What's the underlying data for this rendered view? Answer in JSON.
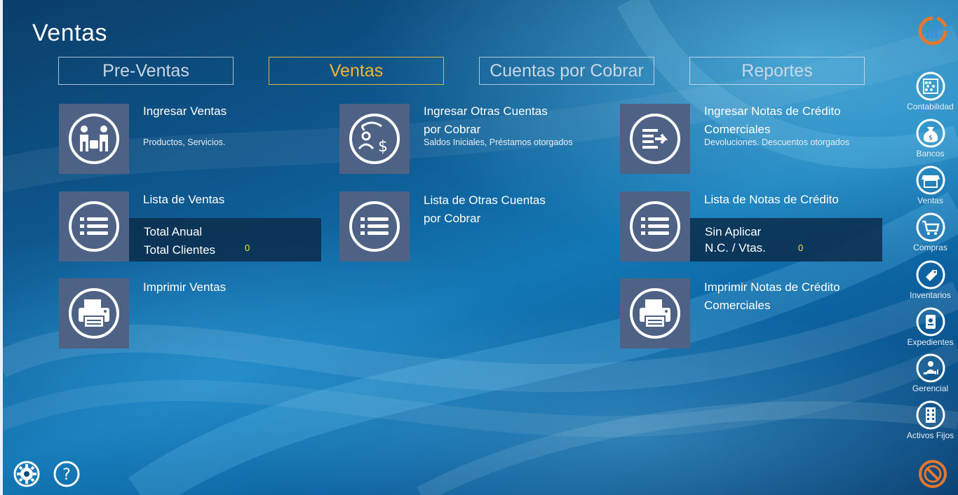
{
  "page": {
    "title": "Ventas"
  },
  "tabs": [
    {
      "label": "Pre-Ventas"
    },
    {
      "label": "Ventas"
    },
    {
      "label": "Cuentas por Cobrar"
    },
    {
      "label": "Reportes"
    }
  ],
  "tiles": {
    "ingresar_ventas": {
      "title": "Ingresar Ventas",
      "subtitle": "Productos, Servicios.",
      "icon": "buyer-seller-icon"
    },
    "ingresar_otras_cuentas": {
      "title_line1": "Ingresar Otras Cuentas",
      "title_line2": "por Cobrar",
      "subtitle": "Saldos Iniciales, Préstamos otorgados",
      "icon": "receivable-icon"
    },
    "ingresar_notas_credito": {
      "title_line1": "Ingresar Notas de Crédito",
      "title_line2": "Comerciales",
      "subtitle": "Devoluciones. Descuentos otorgados",
      "icon": "list-arrow-icon"
    },
    "lista_ventas": {
      "title": "Lista de Ventas",
      "stat_label1": "Total Anual",
      "stat_label2": "Total Clientes",
      "stat_value": "0",
      "icon": "list-icon"
    },
    "lista_otras_cuentas": {
      "title_line1": "Lista de Otras Cuentas",
      "title_line2": "por Cobrar",
      "icon": "list-icon"
    },
    "lista_notas_credito": {
      "title": "Lista de Notas de Crédito",
      "stat_label1": "Sin Aplicar",
      "stat_label2": "N.C. / Vtas.",
      "stat_value": "0",
      "icon": "list-icon"
    },
    "imprimir_ventas": {
      "title": "Imprimir Ventas",
      "icon": "printer-icon"
    },
    "imprimir_notas_credito": {
      "title_line1": "Imprimir Notas de Crédito",
      "title_line2": "Comerciales",
      "icon": "printer-icon"
    }
  },
  "sidebar": {
    "items": [
      {
        "label": "Contabilidad",
        "icon": "abacus-icon"
      },
      {
        "label": "Bancos",
        "icon": "money-bag-icon"
      },
      {
        "label": "Ventas",
        "icon": "store-icon"
      },
      {
        "label": "Compras",
        "icon": "cart-icon"
      },
      {
        "label": "Inventarios",
        "icon": "tag-icon"
      },
      {
        "label": "Expedientes",
        "icon": "id-card-icon"
      },
      {
        "label": "Gerencial",
        "icon": "manager-icon"
      },
      {
        "label": "Activos Fijos",
        "icon": "building-icon"
      }
    ]
  },
  "colors": {
    "accent": "#f2b630",
    "tile_bg": "#4d6285",
    "logo_orange": "#e8772e",
    "stat_value": "#f1e04a"
  }
}
